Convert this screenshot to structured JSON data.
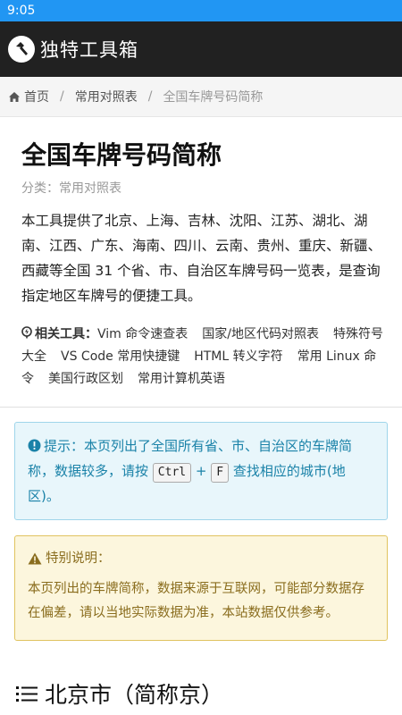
{
  "status_bar": {
    "time": "9:05"
  },
  "app_bar": {
    "title": "独特工具箱"
  },
  "breadcrumb": {
    "home": "首页",
    "sep1": "/",
    "category": "常用对照表",
    "sep2": "/",
    "current": "全国车牌号码简称"
  },
  "page": {
    "title": "全国车牌号码简称",
    "category_label": "分类：",
    "category_value": "常用对照表",
    "intro": "本工具提供了北京、上海、吉林、沈阳、江苏、湖北、湖南、江西、广东、海南、四川、云南、贵州、重庆、新疆、西藏等全国 31 个省、市、自治区车牌号码一览表，是查询指定地区车牌号的便捷工具。"
  },
  "related": {
    "label": "相关工具：",
    "tools": [
      "Vim 命令速查表",
      "国家/地区代码对照表",
      "特殊符号大全",
      "VS Code 常用快捷键",
      "HTML 转义字符",
      "常用 Linux 命令",
      "美国行政区划",
      "常用计算机英语"
    ]
  },
  "tip": {
    "text_before": "提示：本页列出了全国所有省、市、自治区的车牌简称，数据较多，请按",
    "key1": "Ctrl",
    "plus": "+",
    "key2": "F",
    "text_after": "查找相应的城市(地区)。"
  },
  "warning": {
    "title": "特别说明：",
    "body": "本页列出的车牌简称，数据来源于互联网，可能部分数据存在偏差，请以当地实际数据为准，本站数据仅供参考。"
  },
  "section": {
    "title": "北京市（简称京）"
  },
  "colors": {
    "status_bar": "#2196f3",
    "app_bar": "#212121",
    "tip_text": "#1a82a8",
    "tip_bg": "#e8f6fb",
    "warn_text": "#8a6d1e",
    "warn_bg": "#fcf6dd"
  },
  "icons": {
    "logo": "hammer-icon",
    "home": "home-icon",
    "related": "lightning-icon",
    "tip": "info-circle-icon",
    "warning": "warning-triangle-icon",
    "section": "list-icon"
  }
}
